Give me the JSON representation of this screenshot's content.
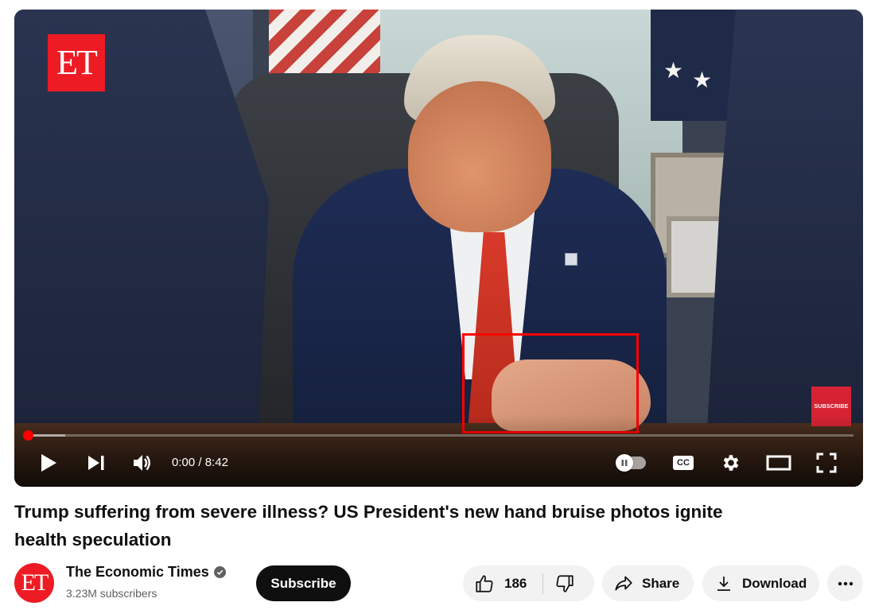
{
  "video": {
    "watermark_logo_text": "ET",
    "subscribe_watermark": "SUBSCRIBE",
    "progress": {
      "played_fraction": 0.0,
      "buffered_fraction": 0.05
    },
    "time_current": "0:00",
    "time_separator": " / ",
    "time_total": "8:42",
    "accent_color": "#ff0000"
  },
  "controls": {
    "icons": [
      "play-icon",
      "next-icon",
      "volume-icon",
      "autoplay-toggle",
      "captions-icon",
      "settings-icon",
      "theater-mode-icon",
      "fullscreen-icon"
    ],
    "captions_label": "CC"
  },
  "title": "Trump suffering from severe illness? US President's new hand bruise photos ignite health speculation",
  "channel": {
    "avatar_text": "ET",
    "name": "The Economic Times",
    "verified": true,
    "subscribers": "3.23M subscribers",
    "subscribe_label": "Subscribe"
  },
  "actions": {
    "likes": "186",
    "share_label": "Share",
    "download_label": "Download"
  }
}
